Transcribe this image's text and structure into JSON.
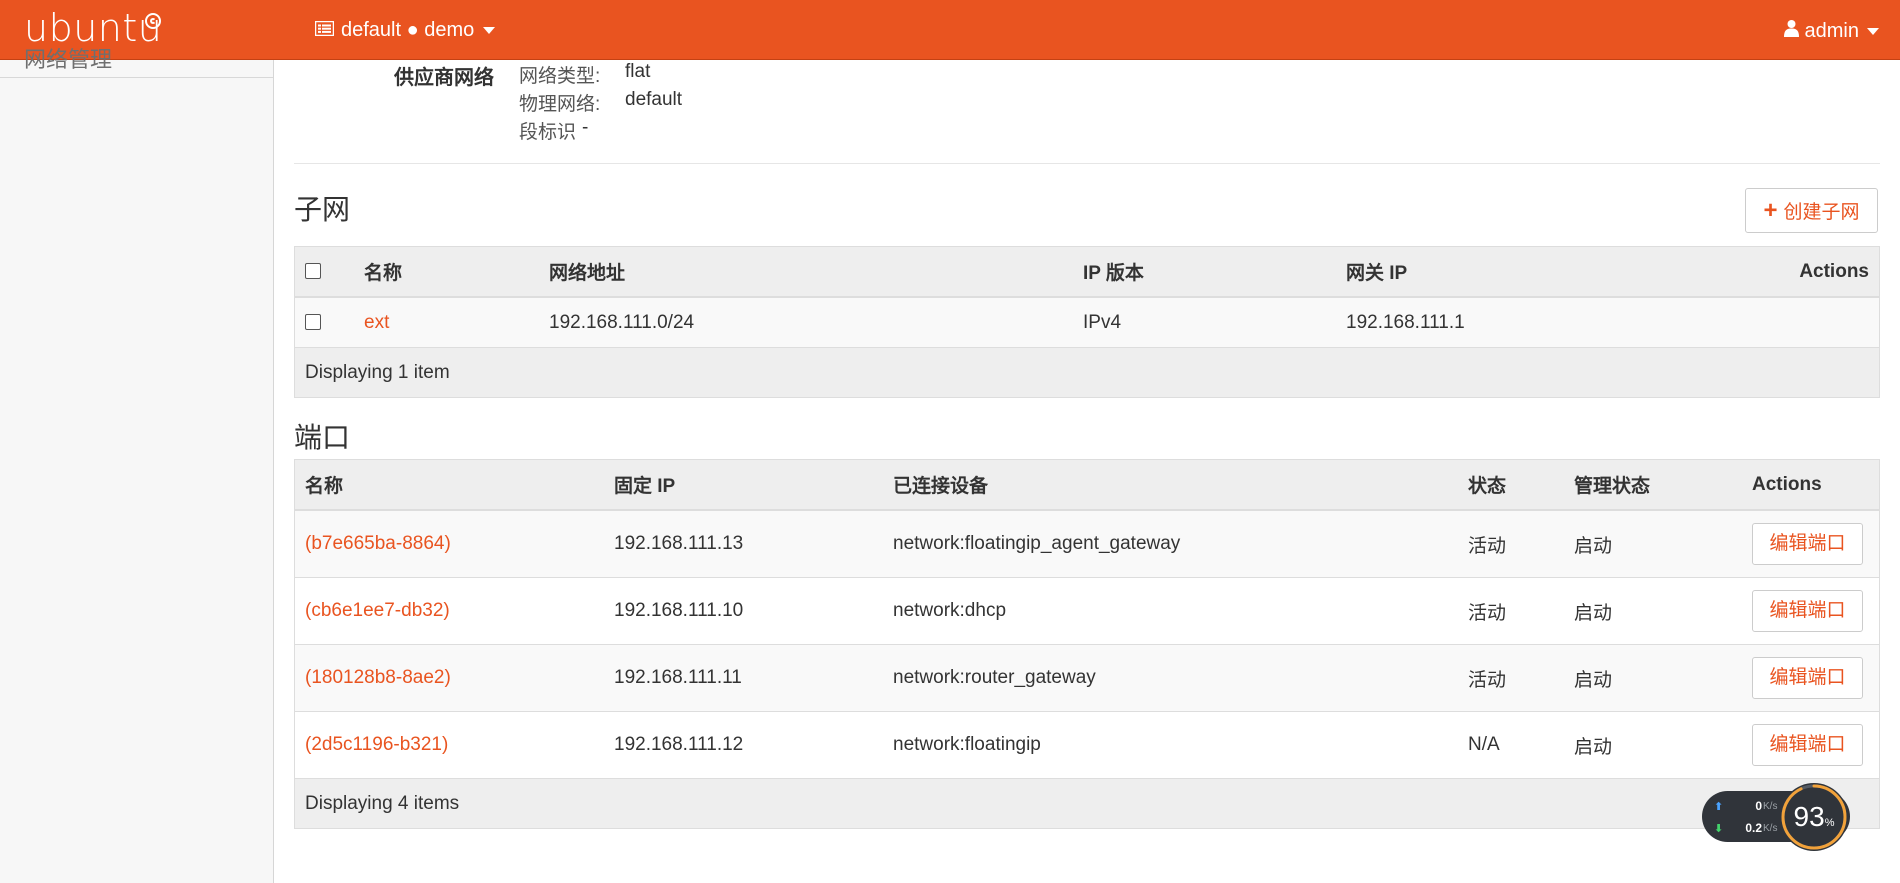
{
  "navbar": {
    "brand": "ubuntu",
    "project_switch": "default ● demo",
    "user": "admin"
  },
  "sidebar": {
    "cut_text": "网络管理"
  },
  "provider_network": {
    "label": "供应商网络",
    "rows": [
      {
        "key": "网络类型:",
        "value": "flat"
      },
      {
        "key": "物理网络:",
        "value": "default"
      },
      {
        "key": "段标识",
        "value": "-"
      }
    ]
  },
  "subnets": {
    "title": "子网",
    "create_button": "创建子网",
    "columns": [
      "名称",
      "网络地址",
      "IP 版本",
      "网关 IP",
      "Actions"
    ],
    "rows": [
      {
        "name": "ext",
        "cidr": "192.168.111.0/24",
        "ip_version": "IPv4",
        "gateway": "192.168.111.1"
      }
    ],
    "footer": "Displaying 1 item"
  },
  "ports": {
    "title": "端口",
    "columns": [
      "名称",
      "固定 IP",
      "已连接设备",
      "状态",
      "管理状态",
      "Actions"
    ],
    "rows": [
      {
        "name": "(b7e665ba-8864)",
        "fixed_ip": "192.168.111.13",
        "device": "network:floatingip_agent_gateway",
        "status": "活动",
        "admin_state": "启动",
        "action": "编辑端口"
      },
      {
        "name": "(cb6e1ee7-db32)",
        "fixed_ip": "192.168.111.10",
        "device": "network:dhcp",
        "status": "活动",
        "admin_state": "启动",
        "action": "编辑端口"
      },
      {
        "name": "(180128b8-8ae2)",
        "fixed_ip": "192.168.111.11",
        "device": "network:router_gateway",
        "status": "活动",
        "admin_state": "启动",
        "action": "编辑端口"
      },
      {
        "name": "(2d5c1196-b321)",
        "fixed_ip": "192.168.111.12",
        "device": "network:floatingip",
        "status": "N/A",
        "admin_state": "启动",
        "action": "编辑端口"
      }
    ],
    "footer": "Displaying 4 items"
  },
  "net_widget": {
    "upload": "0",
    "upload_unit": "K/s",
    "download": "0.2",
    "download_unit": "K/s",
    "percent": "93",
    "percent_unit": "%"
  },
  "colors": {
    "accent": "#e95420",
    "header_bg": "#eeeeee"
  },
  "icons": [
    "project-list-icon",
    "user-icon",
    "chevron-down-icon",
    "plus-icon",
    "upload-arrow-icon",
    "download-arrow-icon"
  ]
}
